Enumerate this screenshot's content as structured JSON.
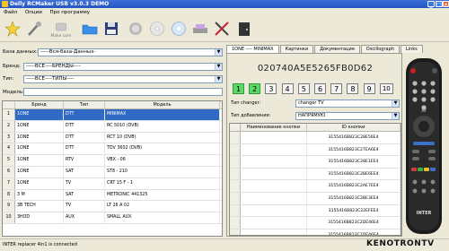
{
  "window": {
    "title": "Delly RCMaker USB v3.0.3 DEMO"
  },
  "menu": [
    "Файл",
    "Опции",
    "Про программу"
  ],
  "toolbar": {
    "tools": [
      {
        "name": "new-icon"
      },
      {
        "name": "wand-icon"
      },
      {
        "name": "make-icon",
        "label": "Make com"
      },
      {
        "name": "open-folder-icon"
      },
      {
        "name": "save-disk-icon"
      },
      {
        "name": "trash-icon"
      },
      {
        "name": "disc-icon"
      },
      {
        "name": "burn-disc-icon"
      },
      {
        "name": "scanner-icon"
      },
      {
        "name": "tools-icon"
      },
      {
        "name": "exit-door-icon"
      }
    ]
  },
  "filters": {
    "db_label": "База данных:",
    "db_value": "-----Вся-база-Данных-",
    "brand_label": "Бренд:",
    "brand_value": "-----ВСЕ----БРЕНДЫ----",
    "type_label": "Тип:",
    "type_value": "-----ВСЕ----ТИПЫ----",
    "model_label": "Модель:",
    "model_value": ""
  },
  "device_table": {
    "columns": [
      "",
      "Бренд",
      "Тип",
      "Модель"
    ],
    "rows": [
      {
        "n": "1",
        "brand": "1ONE",
        "type": "DTT",
        "model": "MINIMAX",
        "selected": true
      },
      {
        "n": "2",
        "brand": "1ONE",
        "type": "DTT",
        "model": "RC 5010 (DVB)"
      },
      {
        "n": "3",
        "brand": "1ONE",
        "type": "DTT",
        "model": "RCT 10 (DVB)"
      },
      {
        "n": "4",
        "brand": "1ONE",
        "type": "DTT",
        "model": "TDV 3602 (DVB)"
      },
      {
        "n": "5",
        "brand": "1ONE",
        "type": "RTV",
        "model": "VBX - 06"
      },
      {
        "n": "6",
        "brand": "1ONE",
        "type": "SAT",
        "model": "ST8 - 210"
      },
      {
        "n": "7",
        "brand": "1ONE",
        "type": "TV",
        "model": "CRT 15 F - 1"
      },
      {
        "n": "8",
        "brand": "3 M",
        "type": "SAT",
        "model": "METRONIC 441325"
      },
      {
        "n": "9",
        "brand": "3B TECH",
        "type": "TV",
        "model": "LT 26 A 02"
      },
      {
        "n": "10",
        "brand": "3HOD",
        "type": "AUX",
        "model": "SMALL AUX"
      }
    ]
  },
  "tabs": [
    {
      "label": "1ONE ---- MINIMAX",
      "active": true
    },
    {
      "label": "Картинки"
    },
    {
      "label": "Документация"
    },
    {
      "label": "Oscillograph"
    },
    {
      "label": "Links"
    }
  ],
  "device_code": "020740A5E5265FB0D62",
  "number_buttons": [
    {
      "label": "1",
      "on": true
    },
    {
      "label": "2",
      "on": true
    },
    {
      "label": "3"
    },
    {
      "label": "4"
    },
    {
      "label": "5"
    },
    {
      "label": "6"
    },
    {
      "label": "7"
    },
    {
      "label": "8"
    },
    {
      "label": "9"
    },
    {
      "label": "10"
    }
  ],
  "changer": {
    "label": "Тип changer:",
    "value": "changer TV"
  },
  "adding": {
    "label": "Тип добавления:",
    "value": "НАПРЯМУЮ"
  },
  "code_table": {
    "columns": [
      "",
      "Наименование кнопки",
      "ID кнопки"
    ],
    "rows": [
      {
        "name": "",
        "id": "3155416B823C28E56E4"
      },
      {
        "name": "",
        "id": "3155416B823C27EA6E4"
      },
      {
        "name": "",
        "id": "3155416B823C28E1EE4"
      },
      {
        "name": "",
        "id": "3155416B823C2BE6EE4"
      },
      {
        "name": "",
        "id": "3155416B823C2AE7EE4"
      },
      {
        "name": "",
        "id": "3155416B823C2BE3EE4"
      },
      {
        "name": "",
        "id": "3155416B823C22EFEE4"
      },
      {
        "name": "",
        "id": "3155416B823C2DE46E4"
      },
      {
        "name": "",
        "id": "3155416B823C2DE46E4"
      }
    ]
  },
  "remote": {
    "brand_text": "INTER",
    "av_text": "AV"
  },
  "status": {
    "text": "INTER replacer 4in1 is connected"
  },
  "watermark": {
    "text": "KENOTRONTV"
  }
}
